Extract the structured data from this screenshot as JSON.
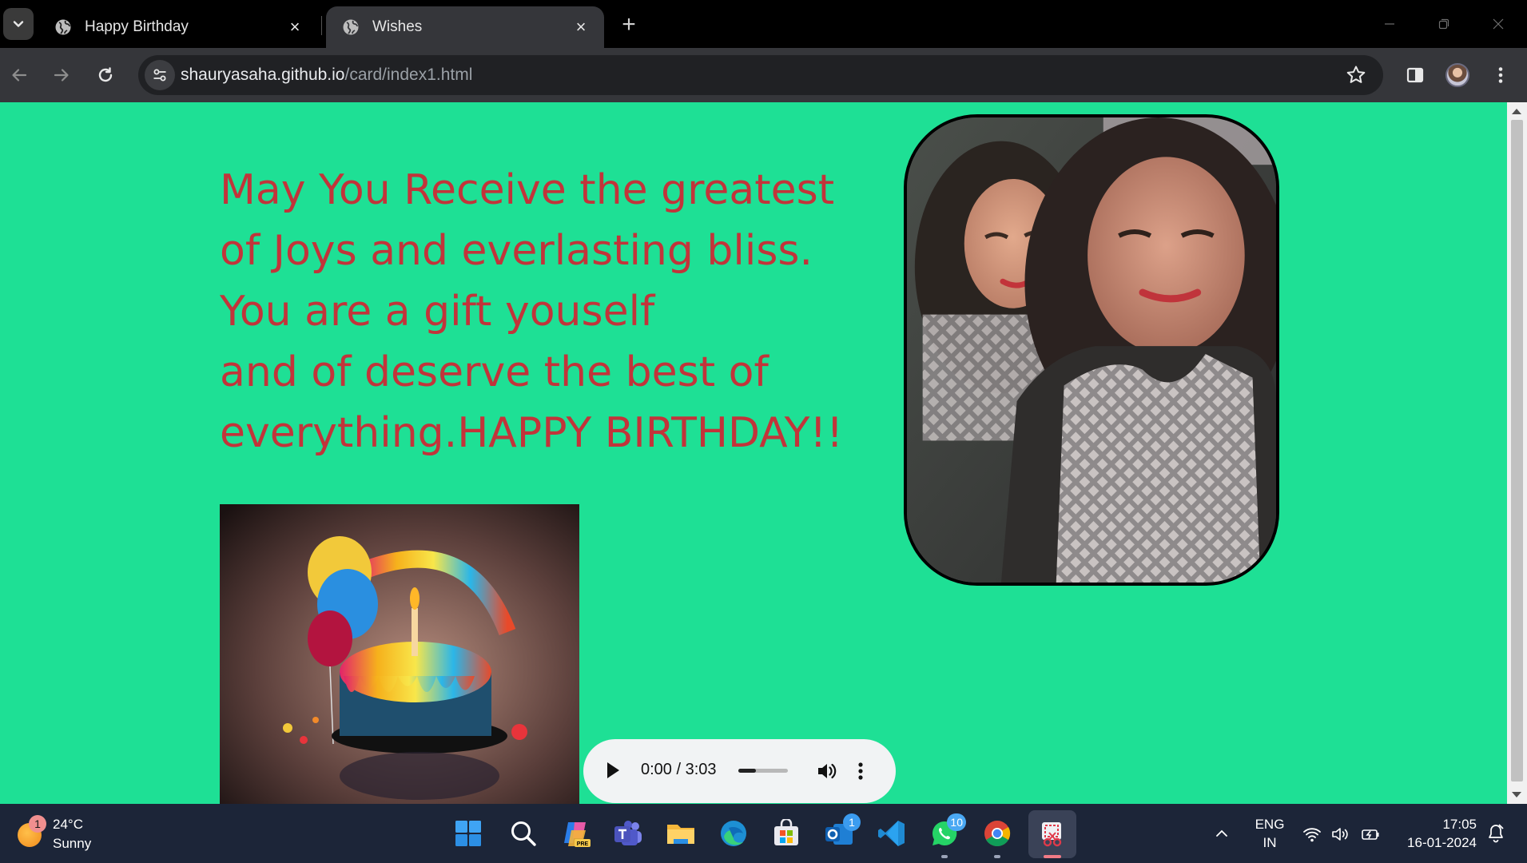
{
  "browser": {
    "tabs": [
      {
        "label": "Happy Birthday",
        "active": false,
        "icon": "globe-icon"
      },
      {
        "label": "Wishes",
        "active": true,
        "icon": "globe-icon"
      }
    ],
    "new_tab_label": "+",
    "url_host": "shauryasaha.github.io",
    "url_path": "/card/index1.html"
  },
  "page": {
    "background_color": "#1ee095",
    "wish_color": "#c2343a",
    "wish_lines": [
      "May You Receive the greatest",
      "of Joys and everlasting bliss.",
      "You are a gift youself",
      "and of deserve the best of",
      "everything.HAPPY BIRTHDAY!!"
    ],
    "photo_icon": "portrait-photo",
    "cake_icon": "birthday-cake-image",
    "audio": {
      "time": "0:00 / 3:03",
      "progress_fraction": 0.0,
      "volume_fraction": 0.35
    }
  },
  "taskbar": {
    "weather": {
      "temp": "24°C",
      "condition": "Sunny",
      "badge": "1"
    },
    "apps": [
      {
        "name": "start-icon"
      },
      {
        "name": "search-icon"
      },
      {
        "name": "copilot-icon"
      },
      {
        "name": "teams-icon"
      },
      {
        "name": "file-explorer-icon"
      },
      {
        "name": "edge-icon"
      },
      {
        "name": "store-icon"
      },
      {
        "name": "outlook-icon",
        "badge": "1"
      },
      {
        "name": "vscode-icon"
      },
      {
        "name": "whatsapp-icon",
        "badge": "10"
      },
      {
        "name": "chrome-icon"
      },
      {
        "name": "snipping-tool-icon"
      }
    ],
    "language": {
      "line1": "ENG",
      "line2": "IN"
    },
    "clock": {
      "time": "17:05",
      "date": "16-01-2024"
    }
  }
}
